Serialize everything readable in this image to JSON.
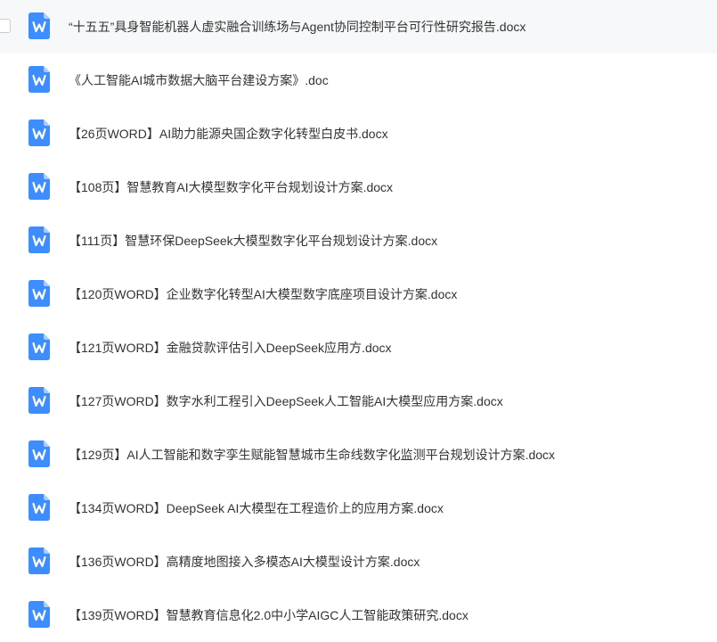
{
  "colors": {
    "icon_blue": "#3d8dff",
    "icon_fold": "#a8ccff",
    "text": "#333333",
    "selected_row_bg": "#f7f8fa"
  },
  "icon": {
    "name": "word-document-icon",
    "glyph": "W"
  },
  "files": [
    {
      "name": "“十五五”具身智能机器人虚实融合训练场与Agent协同控制平台可行性研究报告.docx"
    },
    {
      "name": "《人工智能AI城市数据大脑平台建设方案》.doc"
    },
    {
      "name": "【26页WORD】AI助力能源央国企数字化转型白皮书.docx"
    },
    {
      "name": "【108页】智慧教育AI大模型数字化平台规划设计方案.docx"
    },
    {
      "name": "【111页】智慧环保DeepSeek大模型数字化平台规划设计方案.docx"
    },
    {
      "name": "【120页WORD】企业数字化转型AI大模型数字底座项目设计方案.docx"
    },
    {
      "name": "【121页WORD】金融贷款评估引入DeepSeek应用方.docx"
    },
    {
      "name": "【127页WORD】数字水利工程引入DeepSeek人工智能AI大模型应用方案.docx"
    },
    {
      "name": "【129页】AI人工智能和数字孪生赋能智慧城市生命线数字化监测平台规划设计方案.docx"
    },
    {
      "name": "【134页WORD】DeepSeek AI大模型在工程造价上的应用方案.docx"
    },
    {
      "name": "【136页WORD】高精度地图接入多模态AI大模型设计方案.docx"
    },
    {
      "name": "【139页WORD】智慧教育信息化2.0中小学AIGC人工智能政策研究.docx"
    }
  ]
}
